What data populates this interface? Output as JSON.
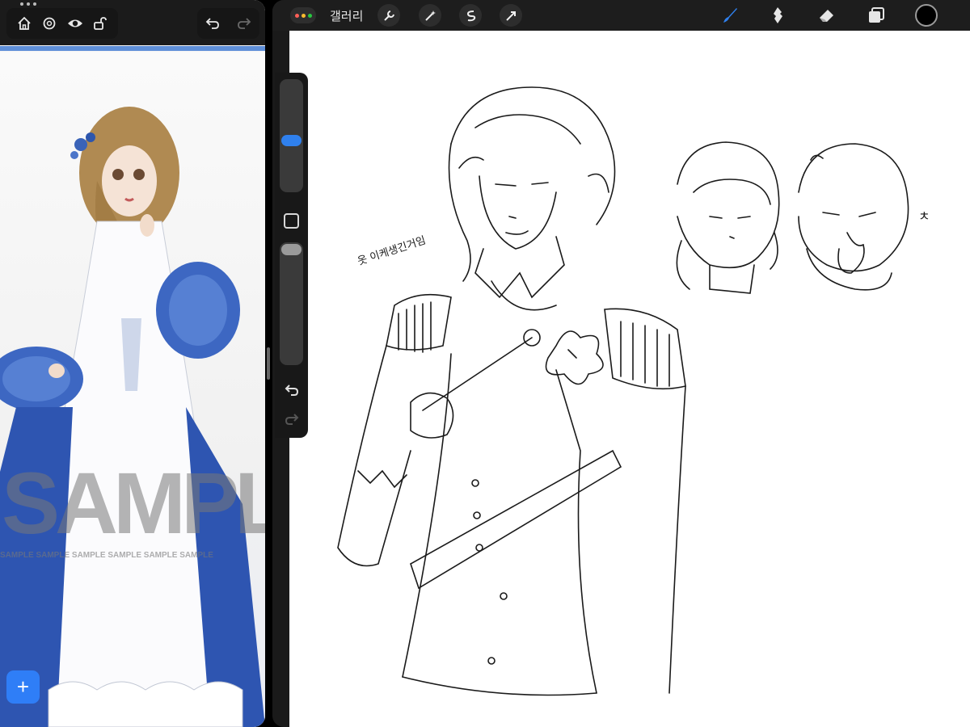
{
  "reference_app": {
    "watermark_big": "SAMPLE",
    "watermark_small": "SAMPLE SAMPLE SAMPLE SAMPLE SAMPLE SAMPLE",
    "add_label": "+",
    "icons": [
      "home-icon",
      "settings-icon",
      "eye-icon",
      "lock-icon",
      "undo-icon",
      "redo-icon"
    ]
  },
  "procreate": {
    "gallery_label": "갤러리",
    "tools_left": [
      "wrench-icon",
      "magic-wand-icon",
      "selection-icon",
      "transform-icon"
    ],
    "tools_right": [
      "brush-icon",
      "smudge-icon",
      "eraser-icon",
      "layers-icon"
    ],
    "brush_size_percent": 45,
    "opacity_percent": 100,
    "accent_color": "#2f80ed",
    "current_color": "#000000"
  },
  "canvas": {
    "annotation_text": "옷 이케생긴거임",
    "side_mark": "ㅊ"
  }
}
